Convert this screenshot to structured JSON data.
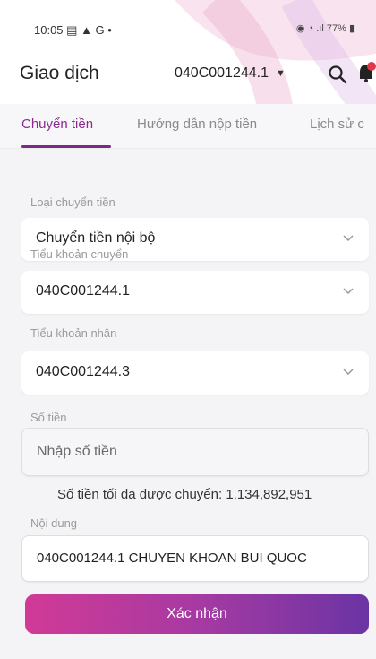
{
  "status_bar": {
    "time": "10:05",
    "left_icons": "▤ ▲ G •",
    "right_text": "77%"
  },
  "header": {
    "title": "Giao dịch",
    "account": "040C001244.1"
  },
  "tabs": [
    {
      "label": "Chuyển tiền"
    },
    {
      "label": "Hướng dẫn nộp tiền"
    },
    {
      "label": "Lịch sử c"
    }
  ],
  "form": {
    "transfer_type_label": "Loại chuyển tiền",
    "transfer_type_value": "Chuyển tiền nội bộ",
    "from_account_label": "Tiểu khoản chuyển",
    "from_account_value": "040C001244.1",
    "to_account_label": "Tiểu khoản nhận",
    "to_account_value": "040C001244.3",
    "amount_label": "Số tiền",
    "amount_placeholder": "Nhập số tiền",
    "max_note": "Số tiền tối đa được chuyển: 1,134,892,951",
    "content_label": "Nội dung",
    "content_value": "040C001244.1 CHUYEN KHOAN BUI QUOC",
    "submit_label": "Xác nhận"
  },
  "colors": {
    "accent": "#8b2a8e",
    "gradient_start": "#d13a96",
    "gradient_end": "#6b34a4"
  }
}
